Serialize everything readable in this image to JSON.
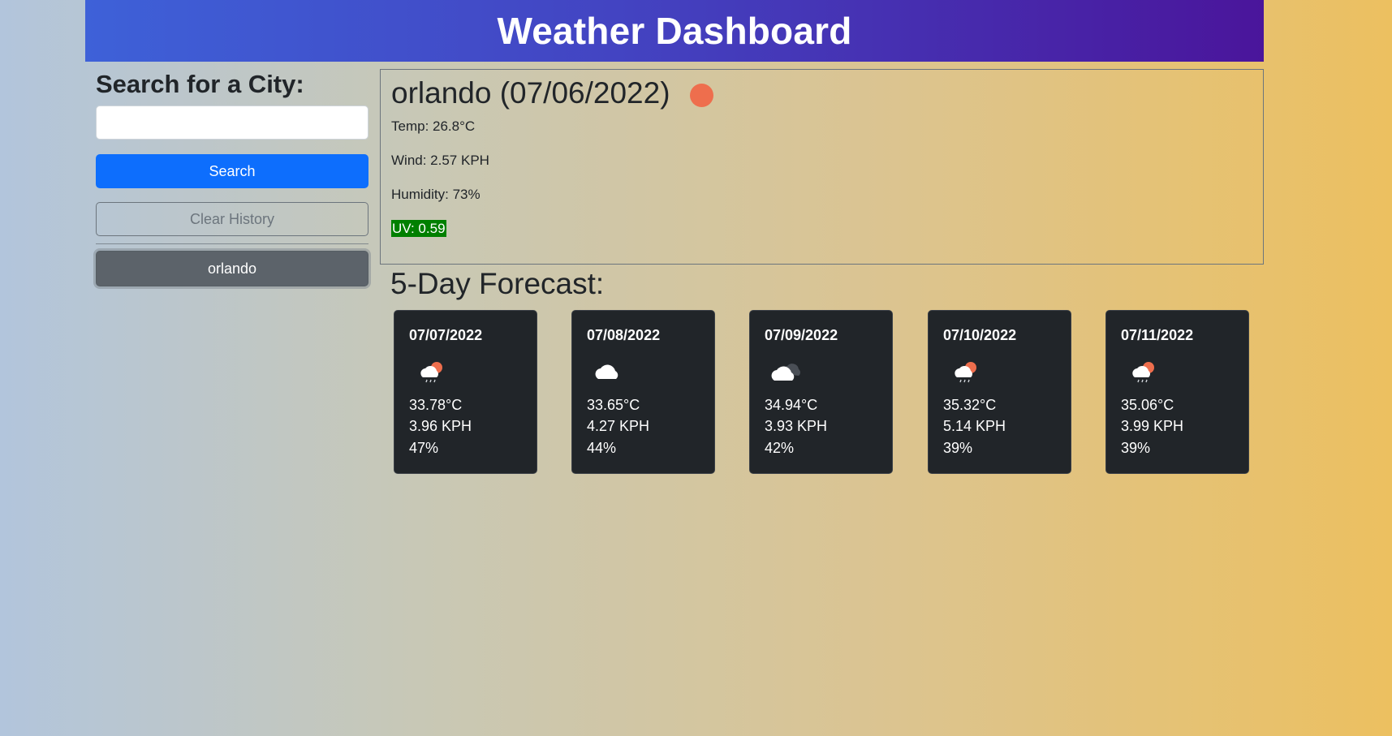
{
  "header": {
    "title": "Weather Dashboard"
  },
  "sidebar": {
    "heading": "Search for a City:",
    "search_value": "",
    "search_button": "Search",
    "clear_button": "Clear History",
    "history": [
      "orlando"
    ]
  },
  "current": {
    "title": "orlando (07/06/2022)",
    "icon": "sun-icon",
    "temp": "Temp: 26.8°C",
    "wind": "Wind: 2.57 KPH",
    "humidity": "Humidity: 73%",
    "uv": "UV: 0.59",
    "uv_color": "#008000"
  },
  "forecast": {
    "heading": "5-Day Forecast:",
    "days": [
      {
        "date": "07/07/2022",
        "icon": "sun-behind-rain-cloud-icon",
        "temp": "33.78°C",
        "wind": "3.96 KPH",
        "humidity": "47%"
      },
      {
        "date": "07/08/2022",
        "icon": "cloud-icon",
        "temp": "33.65°C",
        "wind": "4.27 KPH",
        "humidity": "44%"
      },
      {
        "date": "07/09/2022",
        "icon": "broken-clouds-icon",
        "temp": "34.94°C",
        "wind": "3.93 KPH",
        "humidity": "42%"
      },
      {
        "date": "07/10/2022",
        "icon": "sun-behind-rain-cloud-icon",
        "temp": "35.32°C",
        "wind": "5.14 KPH",
        "humidity": "39%"
      },
      {
        "date": "07/11/2022",
        "icon": "sun-behind-rain-cloud-icon",
        "temp": "35.06°C",
        "wind": "3.99 KPH",
        "humidity": "39%"
      }
    ]
  },
  "colors": {
    "header_gradient_start": "#3e61d8",
    "header_gradient_end": "#4a159b",
    "primary_button": "#0d6efd",
    "history_button": "#5c636a",
    "card_background": "#212529",
    "sun": "#ee6e4d"
  }
}
